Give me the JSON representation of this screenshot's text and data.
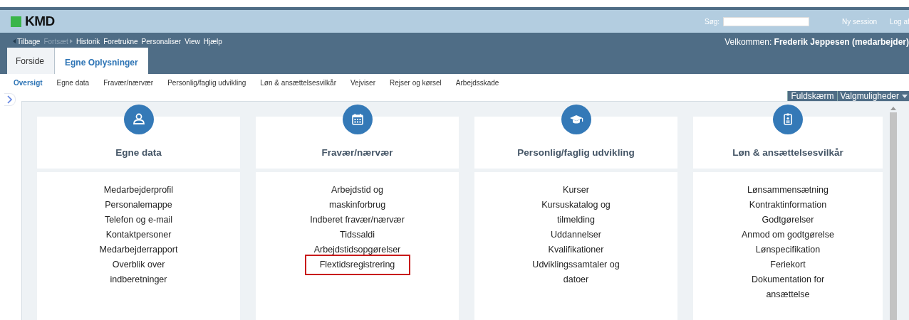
{
  "header": {
    "logo": "KMD",
    "search_label": "Søg:",
    "links": [
      "Ny session",
      "Log af"
    ]
  },
  "toolbar": {
    "items": [
      {
        "label": "Tilbage",
        "disabled": false,
        "kind": "back"
      },
      {
        "label": "Fortsæt",
        "disabled": true,
        "kind": "forward"
      },
      {
        "label": "Historik",
        "disabled": false,
        "kind": "link"
      },
      {
        "label": "Foretrukne",
        "disabled": false,
        "kind": "link"
      },
      {
        "label": "Personaliser",
        "disabled": false,
        "kind": "link"
      },
      {
        "label": "View",
        "disabled": false,
        "kind": "link"
      },
      {
        "label": "Hjælp",
        "disabled": false,
        "kind": "link"
      }
    ],
    "welcome_label": "Velkommen:",
    "user": "Frederik Jeppesen (medarbejder)"
  },
  "tabs": [
    {
      "label": "Forside",
      "selected": false
    },
    {
      "label": "Egne Oplysninger",
      "selected": true
    }
  ],
  "subnav": [
    {
      "label": "Oversigt",
      "selected": true
    },
    {
      "label": "Egne data",
      "selected": false
    },
    {
      "label": "Fravær/nærvær",
      "selected": false
    },
    {
      "label": "Personlig/faglig udvikling",
      "selected": false
    },
    {
      "label": "Løn & ansættelsesvilkår",
      "selected": false
    },
    {
      "label": "Vejviser",
      "selected": false
    },
    {
      "label": "Rejser og kørsel",
      "selected": false
    },
    {
      "label": "Arbejdsskade",
      "selected": false
    }
  ],
  "view_buttons": [
    "Fuldskærm",
    "Valgmuligheder"
  ],
  "cards": [
    {
      "title": "Egne data",
      "links": [
        {
          "label": "Medarbejderprofil",
          "highlighted": false
        },
        {
          "label": "Personalemappe",
          "highlighted": false
        },
        {
          "label": "Telefon og e-mail",
          "highlighted": false
        },
        {
          "label": "Kontaktpersoner",
          "highlighted": false
        },
        {
          "label": "Medarbejderrapport",
          "highlighted": false
        },
        {
          "label": "Overblik over indberetninger",
          "highlighted": false
        }
      ]
    },
    {
      "title": "Fravær/nærvær",
      "links": [
        {
          "label": "Arbejdstid og maskinforbrug",
          "highlighted": false
        },
        {
          "label": "Indberet fravær/nærvær",
          "highlighted": false
        },
        {
          "label": "Tidssaldi",
          "highlighted": false
        },
        {
          "label": "Arbejdstidsopgørelser",
          "highlighted": false
        },
        {
          "label": "Flextidsregistrering",
          "highlighted": true
        }
      ]
    },
    {
      "title": "Personlig/faglig udvikling",
      "links": [
        {
          "label": "Kurser",
          "highlighted": false
        },
        {
          "label": "Kursuskatalog og tilmelding",
          "highlighted": false
        },
        {
          "label": "Uddannelser",
          "highlighted": false
        },
        {
          "label": "Kvalifikationer",
          "highlighted": false
        },
        {
          "label": "Udviklingssamtaler og datoer",
          "highlighted": false
        }
      ]
    },
    {
      "title": "Løn & ansættelsesvilkår",
      "links": [
        {
          "label": "Lønsammensætning",
          "highlighted": false
        },
        {
          "label": "Kontraktinformation",
          "highlighted": false
        },
        {
          "label": "Godtgørelser",
          "highlighted": false
        },
        {
          "label": "Anmod om godtgørelse",
          "highlighted": false
        },
        {
          "label": "Lønspecifikation",
          "highlighted": false
        },
        {
          "label": "Feriekort",
          "highlighted": false
        },
        {
          "label": "Dokumentation for ansættelse",
          "highlighted": false
        }
      ]
    }
  ]
}
